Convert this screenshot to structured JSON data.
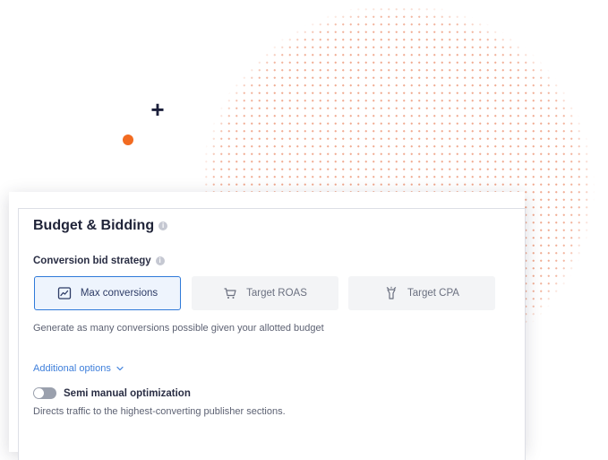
{
  "section": {
    "title": "Budget & Bidding",
    "info_icon": "info-icon"
  },
  "bid_strategy": {
    "label": "Conversion bid strategy",
    "options": [
      {
        "label": "Max conversions",
        "icon": "chart-icon",
        "selected": true
      },
      {
        "label": "Target ROAS",
        "icon": "cart-icon",
        "selected": false
      },
      {
        "label": "Target CPA",
        "icon": "target-cpa-icon",
        "selected": false
      }
    ],
    "description": "Generate as many conversions possible given your allotted budget"
  },
  "additional_options": {
    "label": "Additional options",
    "icon": "chevron-down-icon"
  },
  "semi_manual": {
    "label": "Semi manual optimization",
    "enabled": false,
    "description": "Directs traffic to the highest-converting publisher sections."
  },
  "colors": {
    "accent": "#2f7ad9",
    "link": "#3e7fdb",
    "decor_orange": "#f26b21",
    "decor_dots": "#f0a98f",
    "title": "#1f2338"
  }
}
